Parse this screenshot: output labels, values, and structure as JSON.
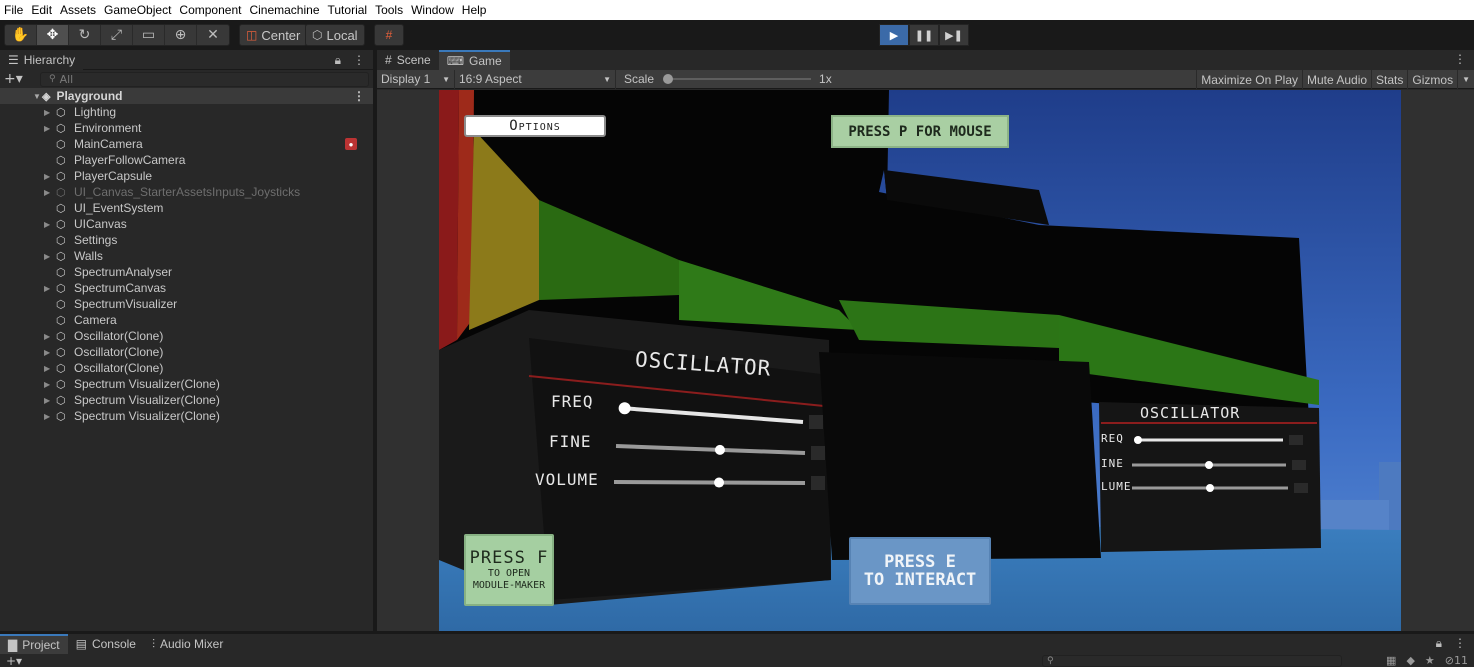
{
  "menu": [
    "File",
    "Edit",
    "Assets",
    "GameObject",
    "Component",
    "Cinemachine",
    "Tutorial",
    "Tools",
    "Window",
    "Help"
  ],
  "toolbar": {
    "tools": [
      {
        "name": "hand-tool",
        "glyph": "✋"
      },
      {
        "name": "move-tool",
        "glyph": "✥"
      },
      {
        "name": "rotate-tool",
        "glyph": "↻"
      },
      {
        "name": "scale-tool",
        "glyph": "⤢"
      },
      {
        "name": "rect-tool",
        "glyph": "▭"
      },
      {
        "name": "transform-tool",
        "glyph": "⊕"
      },
      {
        "name": "custom-tool",
        "glyph": "✕"
      }
    ],
    "pivot_label": "Center",
    "space_label": "Local",
    "snap_glyph": "#"
  },
  "hierarchy": {
    "tab_label": "Hierarchy",
    "search_placeholder": "All",
    "scene_name": "Playground",
    "items": [
      {
        "label": "Lighting",
        "expandable": true,
        "dim": false
      },
      {
        "label": "Environment",
        "expandable": true,
        "dim": false
      },
      {
        "label": "MainCamera",
        "expandable": false,
        "dim": false,
        "badge": true
      },
      {
        "label": "PlayerFollowCamera",
        "expandable": false,
        "dim": false
      },
      {
        "label": "PlayerCapsule",
        "expandable": true,
        "dim": false
      },
      {
        "label": "UI_Canvas_StarterAssetsInputs_Joysticks",
        "expandable": true,
        "dim": true
      },
      {
        "label": "UI_EventSystem",
        "expandable": false,
        "dim": false
      },
      {
        "label": "UICanvas",
        "expandable": true,
        "dim": false
      },
      {
        "label": "Settings",
        "expandable": false,
        "dim": false
      },
      {
        "label": "Walls",
        "expandable": true,
        "dim": false
      },
      {
        "label": "SpectrumAnalyser",
        "expandable": false,
        "dim": false
      },
      {
        "label": "SpectrumCanvas",
        "expandable": true,
        "dim": false
      },
      {
        "label": "SpectrumVisualizer",
        "expandable": false,
        "dim": false
      },
      {
        "label": "Camera",
        "expandable": false,
        "dim": false
      },
      {
        "label": "Oscillator(Clone)",
        "expandable": true,
        "dim": false
      },
      {
        "label": "Oscillator(Clone)",
        "expandable": true,
        "dim": false
      },
      {
        "label": "Oscillator(Clone)",
        "expandable": true,
        "dim": false
      },
      {
        "label": "Spectrum Visualizer(Clone)",
        "expandable": true,
        "dim": false
      },
      {
        "label": "Spectrum Visualizer(Clone)",
        "expandable": true,
        "dim": false
      },
      {
        "label": "Spectrum Visualizer(Clone)",
        "expandable": true,
        "dim": false
      }
    ]
  },
  "game": {
    "tabs": {
      "scene": "Scene",
      "game": "Game"
    },
    "display": "Display 1",
    "aspect": "16:9 Aspect",
    "scale_label": "Scale",
    "scale_value": "1x",
    "right_buttons": [
      "Maximize On Play",
      "Mute Audio",
      "Stats",
      "Gizmos"
    ],
    "hud": {
      "options": "Options",
      "mouse": "PRESS P FOR MOUSE",
      "press_f": "PRESS F",
      "press_f_sub1": "TO OPEN",
      "press_f_sub2": "MODULE-MAKER",
      "press_e1": "PRESS E",
      "press_e2": "TO INTERACT"
    },
    "oscillator_main": {
      "title": "OSCILLATOR",
      "freq": "FREQ",
      "fine": "FINE",
      "volume": "VOLUME",
      "freq_value": 0.02,
      "fine_value": 0.55,
      "volume_value": 0.55
    },
    "oscillator_side": {
      "title": "OSCILLATOR",
      "freq": "REQ",
      "fine": "INE",
      "volume": "LUME",
      "freq_value": 0.02,
      "fine_value": 0.5,
      "volume_value": 0.5
    }
  },
  "bottom": {
    "tabs": [
      "Project",
      "Console",
      "Audio Mixer"
    ],
    "count": "11"
  }
}
